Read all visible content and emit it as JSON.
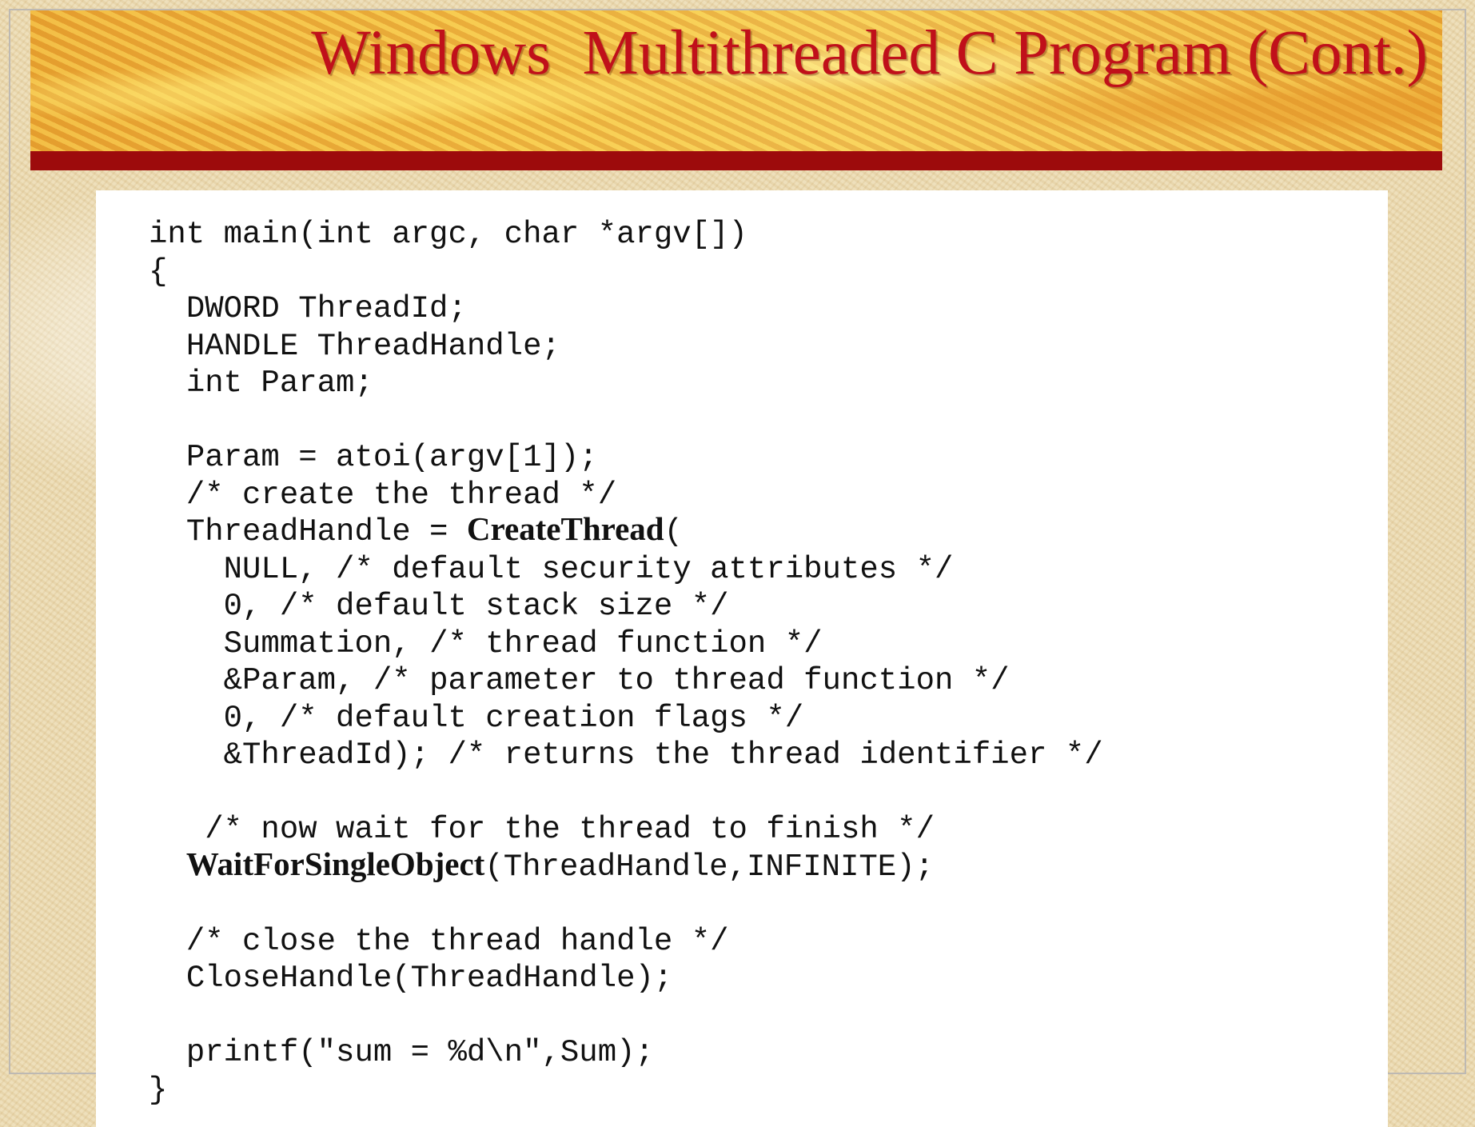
{
  "slide": {
    "title": "Windows  Multithreaded C Program (Cont.)"
  },
  "code": {
    "lines": [
      {
        "indent": "",
        "pre": "int main(int argc, char *argv[])",
        "func": "",
        "post": ""
      },
      {
        "indent": "",
        "pre": "{",
        "func": "",
        "post": ""
      },
      {
        "indent": "  ",
        "pre": "DWORD ThreadId;",
        "func": "",
        "post": ""
      },
      {
        "indent": "  ",
        "pre": "HANDLE ThreadHandle;",
        "func": "",
        "post": ""
      },
      {
        "indent": "  ",
        "pre": "int Param;",
        "func": "",
        "post": ""
      },
      {
        "indent": "",
        "pre": "",
        "func": "",
        "post": ""
      },
      {
        "indent": "  ",
        "pre": "Param = atoi(argv[1]);",
        "func": "",
        "post": ""
      },
      {
        "indent": "  ",
        "pre": "/* create the thread */",
        "func": "",
        "post": ""
      },
      {
        "indent": "  ",
        "pre": "ThreadHandle = ",
        "func": "CreateThread",
        "post": "("
      },
      {
        "indent": "    ",
        "pre": "NULL, /* default security attributes */",
        "func": "",
        "post": ""
      },
      {
        "indent": "    ",
        "pre": "0, /* default stack size */",
        "func": "",
        "post": ""
      },
      {
        "indent": "    ",
        "pre": "Summation, /* thread function */",
        "func": "",
        "post": ""
      },
      {
        "indent": "    ",
        "pre": "&Param, /* parameter to thread function */",
        "func": "",
        "post": ""
      },
      {
        "indent": "    ",
        "pre": "0, /* default creation flags */",
        "func": "",
        "post": ""
      },
      {
        "indent": "    ",
        "pre": "&ThreadId); /* returns the thread identifier */",
        "func": "",
        "post": ""
      },
      {
        "indent": "",
        "pre": "",
        "func": "",
        "post": ""
      },
      {
        "indent": "   ",
        "pre": "/* now wait for the thread to finish */",
        "func": "",
        "post": ""
      },
      {
        "indent": "  ",
        "pre": "",
        "func": "WaitForSingleObject",
        "post": "(ThreadHandle,INFINITE);"
      },
      {
        "indent": "",
        "pre": "",
        "func": "",
        "post": ""
      },
      {
        "indent": "  ",
        "pre": "/* close the thread handle */",
        "func": "",
        "post": ""
      },
      {
        "indent": "  ",
        "pre": "CloseHandle(ThreadHandle);",
        "func": "",
        "post": ""
      },
      {
        "indent": "",
        "pre": "",
        "func": "",
        "post": ""
      },
      {
        "indent": "  ",
        "pre": "printf(\"sum = %d\\n\",Sum);",
        "func": "",
        "post": ""
      },
      {
        "indent": "",
        "pre": "}",
        "func": "",
        "post": ""
      }
    ]
  }
}
